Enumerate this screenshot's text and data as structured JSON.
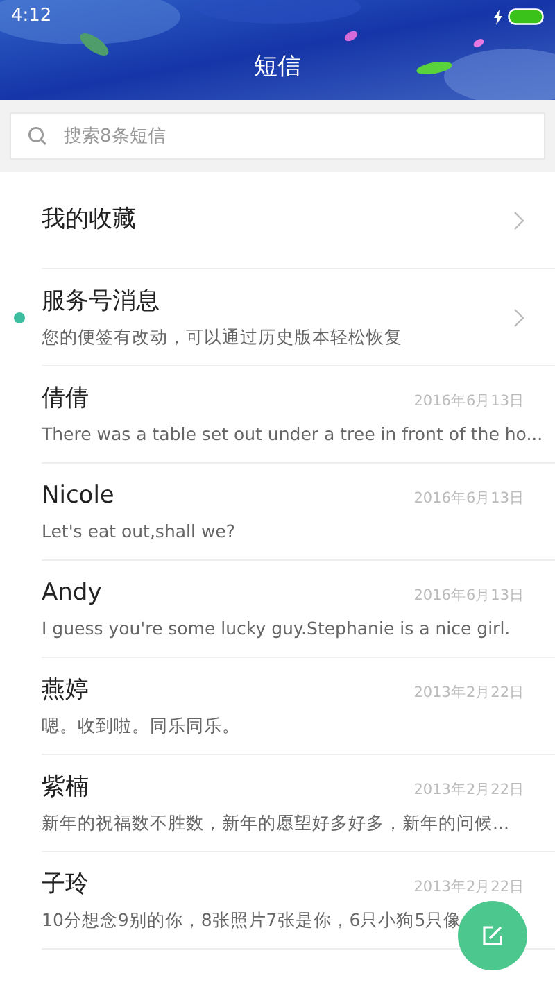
{
  "status_bar": {
    "time": "4:12"
  },
  "header": {
    "title": "短信"
  },
  "search": {
    "placeholder": "搜索8条短信"
  },
  "items": [
    {
      "kind": "folder",
      "name": "我的收藏",
      "unread": false
    },
    {
      "kind": "folder",
      "name": "服务号消息",
      "preview": "您的便签有改动，可以通过历史版本轻松恢复",
      "unread": true
    },
    {
      "kind": "conversation",
      "name": "倩倩",
      "date": "2016年6月13日",
      "preview": "There was a table set out under a tree in front of the ho...",
      "unread": false
    },
    {
      "kind": "conversation",
      "name": "Nicole",
      "date": "2016年6月13日",
      "preview": "Let's eat out,shall we?",
      "unread": false
    },
    {
      "kind": "conversation",
      "name": "Andy",
      "date": "2016年6月13日",
      "preview": "I guess you're some lucky guy.Stephanie is a nice girl.",
      "unread": false
    },
    {
      "kind": "conversation",
      "name": "燕婷",
      "date": "2013年2月22日",
      "preview": "嗯。收到啦。同乐同乐。",
      "unread": false
    },
    {
      "kind": "conversation",
      "name": "紫楠",
      "date": "2013年2月22日",
      "preview": "新年的祝福数不胜数，新年的愿望好多好多，新年的问候...",
      "unread": false
    },
    {
      "kind": "conversation",
      "name": "子玲",
      "date": "2013年2月22日",
      "preview": "10分想念9别的你，8张照片7张是你，6只小狗5只像",
      "unread": false
    }
  ]
}
